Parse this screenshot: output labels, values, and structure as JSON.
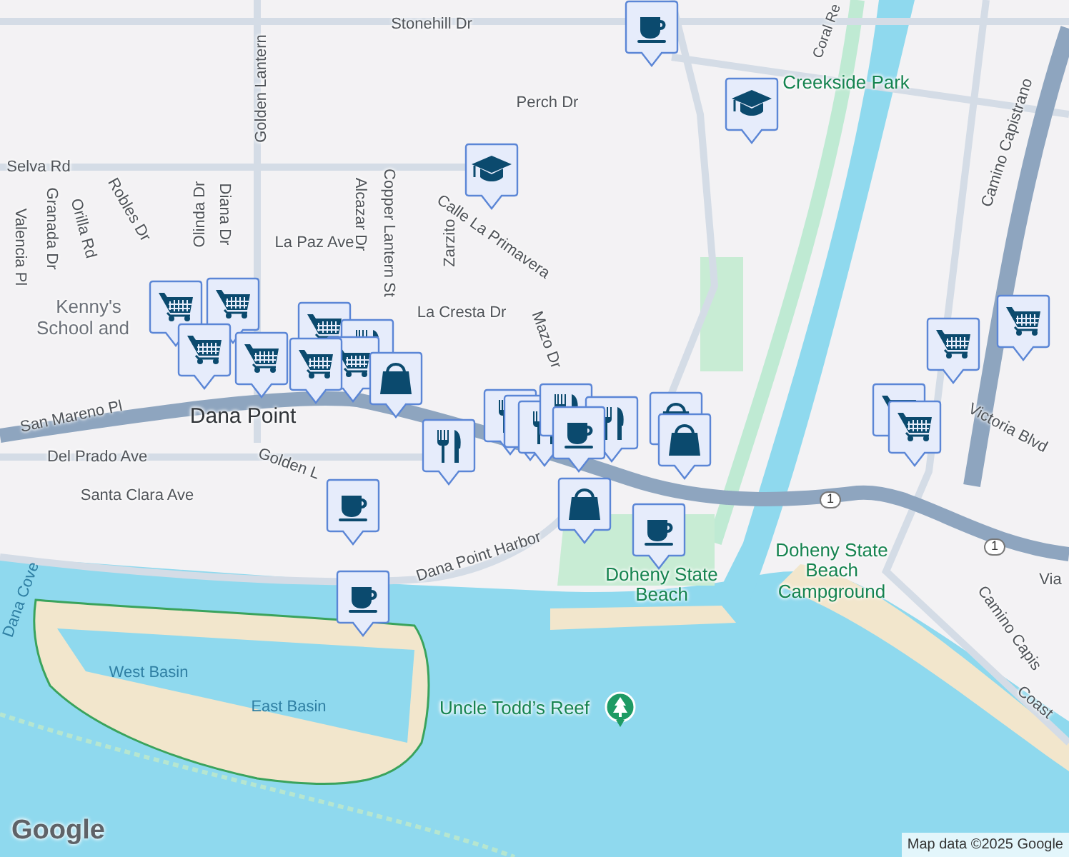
{
  "map": {
    "labels": [
      {
        "text": "Stonehill Dr",
        "kind": "street"
      },
      {
        "text": "Creekside Park",
        "kind": "park"
      },
      {
        "text": "Perch Dr",
        "kind": "street"
      },
      {
        "text": "Selva Rd",
        "kind": "street"
      },
      {
        "text": "Golden Lantern",
        "kind": "street"
      },
      {
        "text": "Valencia Pl",
        "kind": "street"
      },
      {
        "text": "Granada Dr",
        "kind": "street"
      },
      {
        "text": "Orilla Rd",
        "kind": "street"
      },
      {
        "text": "Robles Dr",
        "kind": "street"
      },
      {
        "text": "Olinda Dr",
        "kind": "street"
      },
      {
        "text": "Diana Dr",
        "kind": "street"
      },
      {
        "text": "La Paz Ave",
        "kind": "street"
      },
      {
        "text": "Alcazar Dr",
        "kind": "street"
      },
      {
        "text": "Copper Lantern St",
        "kind": "street"
      },
      {
        "text": "Calle La Primavera",
        "kind": "street"
      },
      {
        "text": "Zarzito",
        "kind": "street"
      },
      {
        "text": "Kenny's",
        "kind": "poi"
      },
      {
        "text": "School and",
        "kind": "poi"
      },
      {
        "text": "La Cresta Dr",
        "kind": "street"
      },
      {
        "text": "Dana Point",
        "kind": "place"
      },
      {
        "text": "San Mareno Pl",
        "kind": "street"
      },
      {
        "text": "Del Prado Ave",
        "kind": "street"
      },
      {
        "text": "Golden L",
        "kind": "street"
      },
      {
        "text": "Santa Clara Ave",
        "kind": "street"
      },
      {
        "text": "Mazo Dr",
        "kind": "street"
      },
      {
        "text": "Dana Point Harbor",
        "kind": "street"
      },
      {
        "text": "Doheny State Beach",
        "kind": "park"
      },
      {
        "text": "Doheny State Beach Campground",
        "kind": "park"
      },
      {
        "text": "Coral Re",
        "kind": "street"
      },
      {
        "text": "Camino Capistrano",
        "kind": "street"
      },
      {
        "text": "Victoria Blvd",
        "kind": "street"
      },
      {
        "text": "Camino Capis",
        "kind": "street"
      },
      {
        "text": "Via",
        "kind": "street"
      },
      {
        "text": "Coast",
        "kind": "street"
      },
      {
        "text": "West Basin",
        "kind": "water"
      },
      {
        "text": "East Basin",
        "kind": "water"
      },
      {
        "text": "Dana Cove",
        "kind": "water"
      },
      {
        "text": "Uncle Todd’s Reef",
        "kind": "park"
      },
      {
        "text": "1",
        "kind": "shield"
      },
      {
        "text": "1",
        "kind": "shield"
      }
    ],
    "markers": [
      {
        "kind": "coffee"
      },
      {
        "kind": "school"
      },
      {
        "kind": "school"
      },
      {
        "kind": "cart"
      },
      {
        "kind": "cart"
      },
      {
        "kind": "cart"
      },
      {
        "kind": "cart"
      },
      {
        "kind": "cart"
      },
      {
        "kind": "restaurant"
      },
      {
        "kind": "cart"
      },
      {
        "kind": "cart"
      },
      {
        "kind": "bag"
      },
      {
        "kind": "restaurant"
      },
      {
        "kind": "restaurant"
      },
      {
        "kind": "restaurant"
      },
      {
        "kind": "restaurant"
      },
      {
        "kind": "restaurant"
      },
      {
        "kind": "restaurant"
      },
      {
        "kind": "coffee"
      },
      {
        "kind": "bag"
      },
      {
        "kind": "bag"
      },
      {
        "kind": "bag"
      },
      {
        "kind": "coffee"
      },
      {
        "kind": "coffee"
      },
      {
        "kind": "coffee"
      },
      {
        "kind": "cart"
      },
      {
        "kind": "cart"
      },
      {
        "kind": "cart"
      },
      {
        "kind": "cart"
      }
    ],
    "logo": "Google",
    "attribution": "Map data ©2025 Google"
  }
}
